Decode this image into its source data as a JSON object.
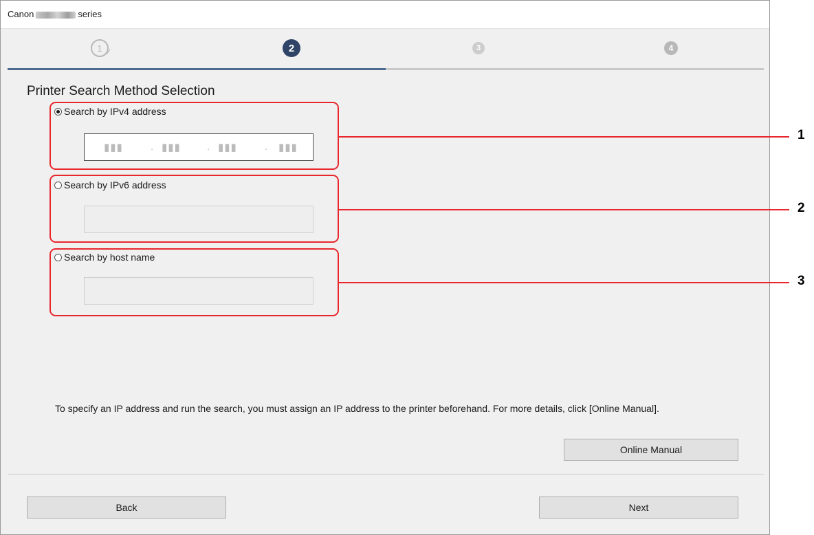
{
  "window": {
    "title_prefix": "Canon",
    "title_suffix": "series"
  },
  "steps": [
    {
      "number": "1",
      "state": "done"
    },
    {
      "number": "2",
      "state": "current"
    },
    {
      "number": "3",
      "state": "upcoming"
    },
    {
      "number": "4",
      "state": "upcoming"
    }
  ],
  "heading": "Printer Search Method Selection",
  "options": [
    {
      "label": "Search by IPv4 address",
      "selected": true,
      "callout": "1"
    },
    {
      "label": "Search by IPv6 address",
      "selected": false,
      "callout": "2"
    },
    {
      "label": "Search by host name",
      "selected": false,
      "callout": "3"
    }
  ],
  "info_text": "To specify an IP address and run the search, you must assign an IP address to the printer beforehand. For more details, click [Online Manual].",
  "buttons": {
    "online_manual": "Online Manual",
    "back": "Back",
    "next": "Next"
  },
  "colors": {
    "callout": "#e8262c",
    "current_step": "#2f4466",
    "progress": "#4a6a92"
  }
}
